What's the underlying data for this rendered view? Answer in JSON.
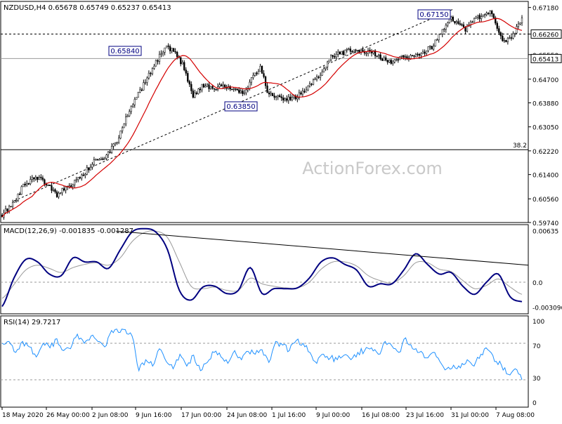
{
  "chart_data": [
    {
      "type": "candlestick",
      "symbol": "NZDUSD,H4",
      "ohlc": {
        "open": "0.65678",
        "high": "0.65749",
        "low": "0.65237",
        "close": "0.65413"
      },
      "ylim": [
        0.5974,
        0.6739
      ],
      "yticks": [
        "0.67180",
        "0.66260",
        "0.65550",
        "0.64700",
        "0.63880",
        "0.63050",
        "0.62220",
        "0.61400",
        "0.60560",
        "0.59740"
      ],
      "x_labels": [
        "18 May 2020",
        "26 May 00:00",
        "2 Jun 08:00",
        "9 Jun 16:00",
        "17 Jun 00:00",
        "24 Jun 08:00",
        "1 Jul 16:00",
        "9 Jul 00:00",
        "16 Jul 08:00",
        "23 Jul 16:00",
        "31 Jul 00:00",
        "7 Aug 08:00"
      ],
      "n_bars": 295,
      "current_price": "0.65413",
      "annotations": [
        {
          "text": "0.65840",
          "value": 0.6584
        },
        {
          "text": "0.63850",
          "value": 0.6385
        },
        {
          "text": "0.67150",
          "value": 0.6715
        }
      ],
      "levels": [
        {
          "value": 0.6626,
          "label": "0.66260",
          "style": "dashed",
          "color": "#000000"
        },
        {
          "value": 0.65413,
          "label": "0.65413",
          "style": "solid",
          "color": "#9a9a9a"
        },
        {
          "value": 0.6226,
          "label": "38.2",
          "style": "solid",
          "color": "#000000"
        }
      ],
      "trendline": {
        "style": "dashed",
        "from": 0.6049,
        "to": 0.6712
      },
      "ma": {
        "color": "#d40000",
        "description": "moving average"
      },
      "watermark": "ActionForex.com",
      "candles": [
        {
          "bar": 0,
          "c": 0.6
        },
        {
          "bar": 6,
          "c": 0.604
        },
        {
          "bar": 13,
          "c": 0.611
        },
        {
          "bar": 19,
          "c": 0.613
        },
        {
          "bar": 25,
          "c": 0.611
        },
        {
          "bar": 31,
          "c": 0.607
        },
        {
          "bar": 38,
          "c": 0.61
        },
        {
          "bar": 45,
          "c": 0.613
        },
        {
          "bar": 52,
          "c": 0.619
        },
        {
          "bar": 58,
          "c": 0.619
        },
        {
          "bar": 66,
          "c": 0.627
        },
        {
          "bar": 73,
          "c": 0.638
        },
        {
          "bar": 80,
          "c": 0.645
        },
        {
          "bar": 87,
          "c": 0.653
        },
        {
          "bar": 92,
          "c": 0.658
        },
        {
          "bar": 97,
          "c": 0.657
        },
        {
          "bar": 103,
          "c": 0.651
        },
        {
          "bar": 108,
          "c": 0.641
        },
        {
          "bar": 113,
          "c": 0.645
        },
        {
          "bar": 119,
          "c": 0.644
        },
        {
          "bar": 125,
          "c": 0.645
        },
        {
          "bar": 131,
          "c": 0.643
        },
        {
          "bar": 137,
          "c": 0.642
        },
        {
          "bar": 142,
          "c": 0.648
        },
        {
          "bar": 146,
          "c": 0.651
        },
        {
          "bar": 150,
          "c": 0.643
        },
        {
          "bar": 155,
          "c": 0.641
        },
        {
          "bar": 161,
          "c": 0.64
        },
        {
          "bar": 167,
          "c": 0.641
        },
        {
          "bar": 173,
          "c": 0.644
        },
        {
          "bar": 179,
          "c": 0.648
        },
        {
          "bar": 186,
          "c": 0.655
        },
        {
          "bar": 192,
          "c": 0.656
        },
        {
          "bar": 198,
          "c": 0.657
        },
        {
          "bar": 204,
          "c": 0.657
        },
        {
          "bar": 210,
          "c": 0.656
        },
        {
          "bar": 215,
          "c": 0.654
        },
        {
          "bar": 220,
          "c": 0.653
        },
        {
          "bar": 225,
          "c": 0.655
        },
        {
          "bar": 231,
          "c": 0.655
        },
        {
          "bar": 237,
          "c": 0.656
        },
        {
          "bar": 243,
          "c": 0.658
        },
        {
          "bar": 249,
          "c": 0.664
        },
        {
          "bar": 253,
          "c": 0.668
        },
        {
          "bar": 257,
          "c": 0.667
        },
        {
          "bar": 262,
          "c": 0.664
        },
        {
          "bar": 267,
          "c": 0.668
        },
        {
          "bar": 272,
          "c": 0.669
        },
        {
          "bar": 276,
          "c": 0.671
        },
        {
          "bar": 280,
          "c": 0.664
        },
        {
          "bar": 284,
          "c": 0.66
        },
        {
          "bar": 288,
          "c": 0.661
        },
        {
          "bar": 292,
          "c": 0.666
        },
        {
          "bar": 296,
          "c": 0.669
        },
        {
          "bar": 300,
          "c": 0.666
        },
        {
          "bar": 304,
          "c": 0.664
        },
        {
          "bar": 308,
          "c": 0.661
        },
        {
          "bar": 312,
          "c": 0.659
        },
        {
          "bar": 316,
          "c": 0.6541
        }
      ]
    },
    {
      "type": "line",
      "title": "MACD(12,26,9) -0.001835 -0.001287",
      "ylim": [
        -0.0039,
        0.0071
      ],
      "yticks": [
        "0.00635",
        "0.0",
        "0.0",
        "-0.003096"
      ],
      "trendline": {
        "from": 0.0063,
        "to": 0.0021
      },
      "series": [
        {
          "role": "macd",
          "color": "#000080",
          "values": [
            -0.003,
            0.0005,
            0.0028,
            0.0025,
            0.001,
            0.0008,
            0.003,
            0.0025,
            0.0025,
            0.0017,
            0.004,
            0.0062,
            0.0066,
            0.0062,
            0.004,
            -0.001,
            -0.0022,
            -0.0006,
            -0.0005,
            -0.0014,
            -0.001,
            0.0018,
            -0.0014,
            -0.0008,
            -0.0008,
            -0.0007,
            0.0005,
            0.0025,
            0.003,
            0.0022,
            0.0015,
            -0.0005,
            -0.0002,
            -0.0002,
            0.0015,
            0.0035,
            0.0022,
            0.001,
            0.0012,
            -0.0005,
            -0.0015,
            0.0,
            0.001,
            -0.0018,
            -0.0024
          ]
        },
        {
          "role": "signal",
          "color": "#9a9a9a",
          "values": [
            -0.002,
            -0.0003,
            0.0015,
            0.0021,
            0.0017,
            0.0012,
            0.0018,
            0.0022,
            0.0024,
            0.0021,
            0.003,
            0.005,
            0.0061,
            0.0063,
            0.0055,
            0.0025,
            -0.0005,
            -0.0008,
            -0.0006,
            -0.001,
            -0.001,
            0.0005,
            -0.0002,
            -0.0005,
            -0.0007,
            -0.0007,
            0.0,
            0.0016,
            0.0025,
            0.0025,
            0.002,
            0.0008,
            0.0002,
            -0.0001,
            0.0008,
            0.0024,
            0.0024,
            0.0016,
            0.0013,
            0.0002,
            -0.0008,
            -0.0004,
            0.0004,
            -0.0006,
            -0.0015
          ]
        }
      ]
    },
    {
      "type": "line",
      "title": "RSI(14) 29.7217",
      "ylim": [
        0,
        100
      ],
      "yticks": [
        "100",
        "70",
        "30",
        "0"
      ],
      "levels": [
        70,
        30
      ],
      "series": [
        {
          "role": "rsi",
          "color": "#1e90ff",
          "values": [
            70,
            72,
            60,
            72,
            66,
            55,
            70,
            65,
            75,
            62,
            64,
            80,
            70,
            78,
            72,
            66,
            84,
            82,
            85,
            78,
            40,
            52,
            45,
            64,
            50,
            42,
            58,
            45,
            57,
            40,
            49,
            60,
            55,
            48,
            62,
            52,
            61,
            58,
            63,
            49,
            72,
            68,
            62,
            73,
            70,
            60,
            48,
            58,
            54,
            52,
            57,
            52,
            60,
            62,
            65,
            58,
            72,
            67,
            60,
            76,
            64,
            60,
            54,
            60,
            50,
            42,
            46,
            43,
            52,
            45,
            58,
            63,
            50,
            46,
            36,
            42,
            30
          ]
        }
      ]
    }
  ]
}
